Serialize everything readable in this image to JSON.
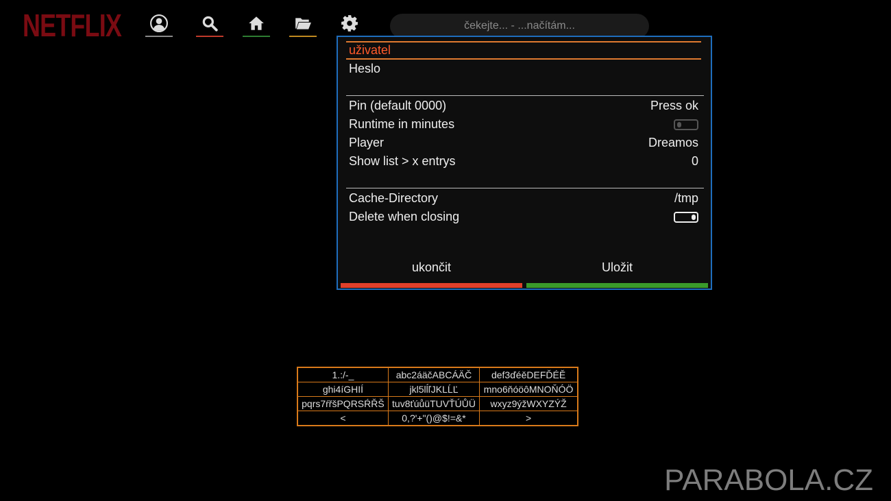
{
  "brand": {
    "logo_text": "NETFLIX"
  },
  "nav": [
    {
      "icon": "user-icon",
      "underline_color": "#8a8a8a"
    },
    {
      "icon": "search-icon",
      "underline_color": "#c0392b"
    },
    {
      "icon": "home-icon",
      "underline_color": "#2e7d32"
    },
    {
      "icon": "folder-icon",
      "underline_color": "#c08a20"
    },
    {
      "icon": "gear-icon",
      "underline_color": null
    }
  ],
  "status_text": "čekejte... - ...načítám...",
  "settings": {
    "items": [
      {
        "label": "uživatel",
        "value": "",
        "selected": true
      },
      {
        "label": "Heslo",
        "value": ""
      },
      {
        "label": "Pin (default 0000)",
        "value": "Press ok"
      },
      {
        "label": "Runtime in minutes",
        "value": "",
        "toggle": "off"
      },
      {
        "label": "Player",
        "value": "Dreamos"
      },
      {
        "label": "Show list > x entrys",
        "value": "0"
      },
      {
        "label": "Cache-Directory",
        "value": "/tmp"
      },
      {
        "label": "Delete when closing",
        "value": "",
        "toggle": "on"
      }
    ],
    "buttons": {
      "cancel": {
        "label": "ukončit",
        "color": "#e0402a"
      },
      "save": {
        "label": "Uložit",
        "color": "#3a9a2a"
      }
    }
  },
  "keyboard": [
    [
      "1.:/-_",
      "abc2áäčABCÁÄČ",
      "def3ďéěDEFĎÉĚ"
    ],
    [
      "ghi4íGHIÍ",
      "jkl5lĺľJKLĹĽ",
      "mno6ňóöôMNOŇÓÖ"
    ],
    [
      "pqrs7ŕřšPQRSŔŘŠ",
      "tuv8ťúůüTUVŤÚŮÜ",
      "wxyz9ýžWXYZÝŽ"
    ],
    [
      "<",
      "0,?'+\"()@$!=&*",
      ">"
    ]
  ],
  "watermark": "PARABOLA.CZ",
  "colors": {
    "dialog_border": "#1e6ebe",
    "selection": "#e07a30",
    "keyboard_border": "#d97a1a"
  }
}
